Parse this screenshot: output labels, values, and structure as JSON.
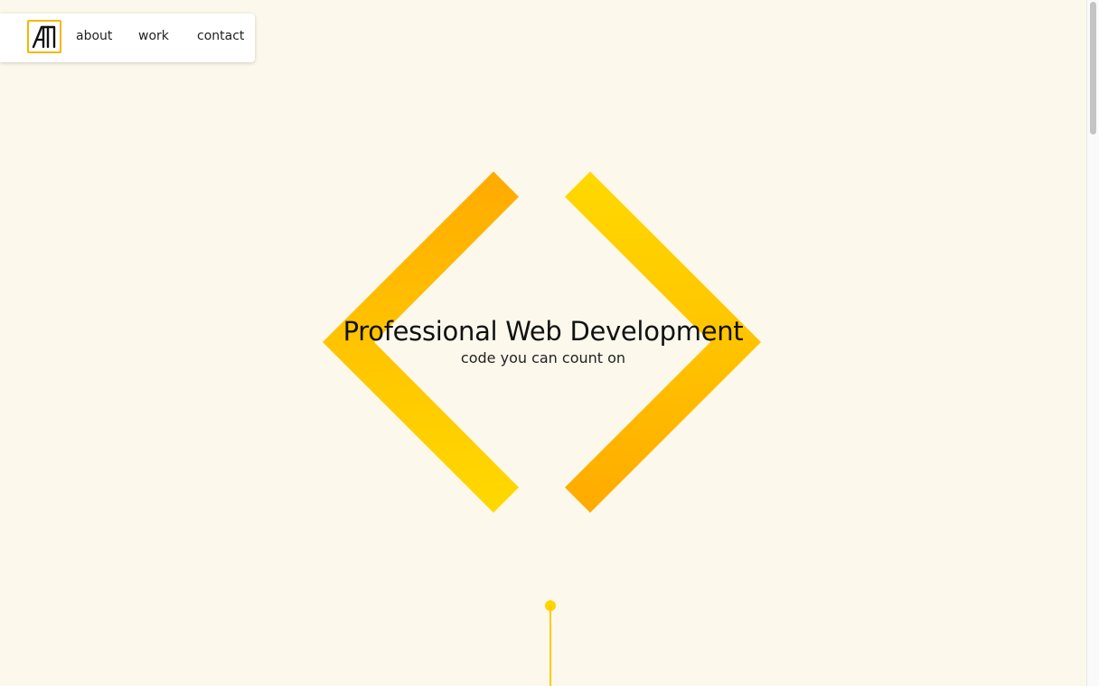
{
  "nav": {
    "logo_text": "AΠ",
    "items": [
      {
        "label": "about"
      },
      {
        "label": "work"
      },
      {
        "label": "contact"
      }
    ]
  },
  "hero": {
    "title": "Professional Web Development",
    "subtitle": "code you can count on"
  },
  "colors": {
    "background": "#fcf8ec",
    "accent_light": "#ffd900",
    "accent_dark": "#ffaa00",
    "logo_border": "#f7b600"
  },
  "icons": {
    "logo": "ap-monogram-logo",
    "brackets": "code-bracket-icon",
    "scroll_cue": "scroll-down-indicator-icon"
  }
}
